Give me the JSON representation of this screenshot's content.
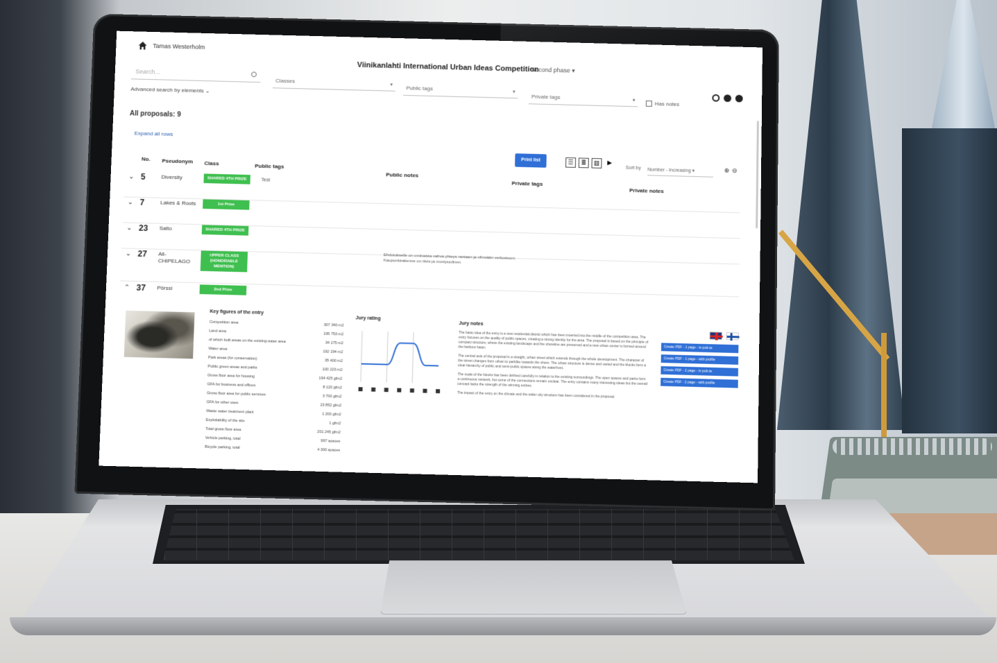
{
  "app": {
    "user_name": "Tamas Westerholm",
    "title": "Viinikanlahti International Urban Ideas Competition",
    "stage": "Second phase"
  },
  "search": {
    "placeholder": "Search...",
    "advanced_label": "Advanced search by elements",
    "classes_placeholder": "Classes",
    "public_tags_placeholder": "Public tags",
    "private_tags_placeholder": "Private tags",
    "has_notes_label": "Has notes"
  },
  "list": {
    "count_label": "All proposals: 9",
    "expand_all": "Expand all rows",
    "print_button": "Print list",
    "sort_label": "Sort by",
    "sort_value": "Number - Increasing",
    "columns": [
      "No.",
      "Pseudonym",
      "Class",
      "Public tags",
      "Public notes",
      "Private tags",
      "Private notes"
    ]
  },
  "rows": [
    {
      "num": "5",
      "pseudonym": "Diversity",
      "class": "SHARED 4TH PRIZE",
      "public_tags": "Test",
      "public_notes": "",
      "expanded": false
    },
    {
      "num": "7",
      "pseudonym": "Lakes & Roots",
      "class": "1st Prize",
      "public_tags": "",
      "public_notes": "",
      "expanded": false
    },
    {
      "num": "23",
      "pseudonym": "Salto",
      "class": "SHARED 4TH PRIZE",
      "public_tags": "",
      "public_notes": "",
      "expanded": false
    },
    {
      "num": "27",
      "pseudonym": "All-CHIPELAGO",
      "class": "UPPER CLASS (HONORABLE MENTION)",
      "public_tags": "",
      "public_notes": "Ehdotukselle on ominaista vahva yhteys rantaan ja vihreään verkostoon. Kaupunkirakenne on tiivis ja monipuolinen.",
      "expanded": false
    },
    {
      "num": "37",
      "pseudonym": "Pörssi",
      "class": "2nd Prize",
      "public_tags": "",
      "public_notes": "",
      "expanded": true
    }
  ],
  "detail": {
    "key_figures_title": "Key figures of the entry",
    "key_figures": [
      {
        "label": "Competition area",
        "value": "307 340 m2"
      },
      {
        "label": "Land area",
        "value": "195 753 m2"
      },
      {
        "label": "of which built areas on the existing water area",
        "value": "34 175 m2"
      },
      {
        "label": "Water area",
        "value": "192 194 m2"
      },
      {
        "label": "Park areas (for conservation)",
        "value": "35 400 m2"
      },
      {
        "label": "Public green areas and parks",
        "value": "100 223 m2"
      },
      {
        "label": "Gross floor area for housing",
        "value": "164 425 gfm2"
      },
      {
        "label": "GFA for business and offices",
        "value": "8 120 gfm2"
      },
      {
        "label": "Gross floor area for public services",
        "value": "3 700 gfm2"
      },
      {
        "label": "GFA for other uses",
        "value": "23 852 gfm2"
      },
      {
        "label": "Waste water treatment plant",
        "value": "1 200 gfm2"
      },
      {
        "label": "Exploitability of the site",
        "value": "1 gfm2"
      },
      {
        "label": "Total gross floor area",
        "value": "201 245 gfm2"
      },
      {
        "label": "Vehicle parking, total",
        "value": "997 spaces"
      },
      {
        "label": "Bicycle parking, total",
        "value": "4 300 spaces"
      }
    ],
    "jury_rating_title": "Jury rating",
    "jury_rating_levels": [
      0.35,
      0.35,
      0.35,
      0.78,
      0.78,
      0.35,
      0.35
    ],
    "jury_rating_icons": [
      "building-icon",
      "transit-icon",
      "people-icon",
      "nature-icon",
      "energy-icon",
      "housing-icon",
      "grid-icon"
    ],
    "jury_notes_title": "Jury notes",
    "jury_notes": [
      "The basic idea of the entry is a new residential district which has been inserted into the middle of the competition area. The entry focuses on the quality of public spaces, creating a strong identity for the area. The proposal is based on the principle of compact structure, where the existing landscape and the shoreline are preserved and a new urban center is formed around the harbour basin.",
      "The central axis of the proposal is a straight, urban street which extends through the whole development. The character of the street changes from urban to parklike towards the shore. The urban structure is dense and varied and the blocks form a clear hierarchy of public and semi-public spaces along the waterfront.",
      "The scale of the blocks has been defined carefully in relation to the existing surroundings. The open spaces and parks form a continuous network, but some of the connections remain unclear. The entry contains many interesting ideas but the overall concept lacks the strength of the winning entries.",
      "The impact of the entry on the climate and the wider city structure has been considered in the proposal."
    ],
    "pdf_buttons": [
      "Create PDF - 1 page - in pub.ta",
      "Create PDF - 1 page - with profile",
      "Create PDF - 2 page - in pub.ta",
      "Create PDF - 2 page - with profile"
    ]
  },
  "colors": {
    "prize_green": "#3fbf4f",
    "primary_blue": "#2f6fd6"
  }
}
